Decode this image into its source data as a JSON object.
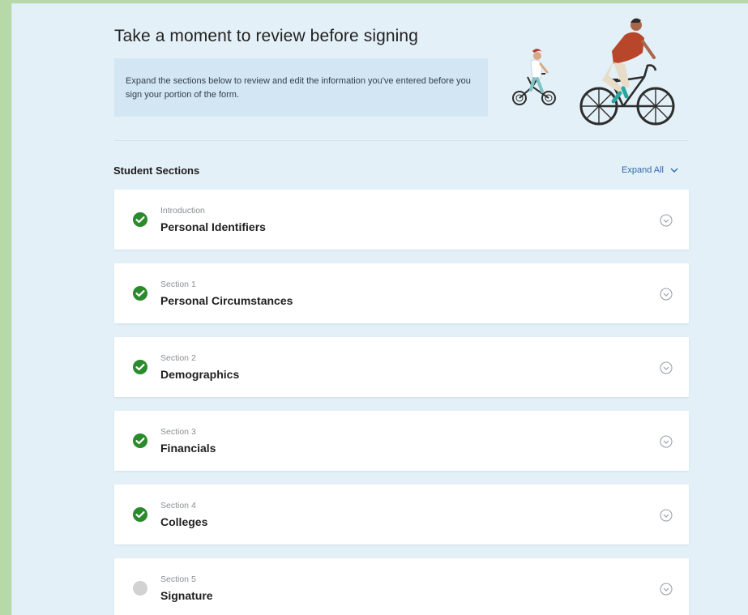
{
  "page": {
    "title": "Take a moment to review before signing",
    "intro": "Expand the sections below to review and edit the information you've entered before you sign your portion of the form."
  },
  "student_sections": {
    "heading": "Student Sections",
    "expand_all_label": "Expand All",
    "items": [
      {
        "kicker": "Introduction",
        "title": "Personal Identifiers",
        "status": "complete"
      },
      {
        "kicker": "Section 1",
        "title": "Personal Circumstances",
        "status": "complete"
      },
      {
        "kicker": "Section 2",
        "title": "Demographics",
        "status": "complete"
      },
      {
        "kicker": "Section 3",
        "title": "Financials",
        "status": "complete"
      },
      {
        "kicker": "Section 4",
        "title": "Colleges",
        "status": "complete"
      },
      {
        "kicker": "Section 5",
        "title": "Signature",
        "status": "incomplete"
      }
    ]
  },
  "icons": {
    "complete": "check-circle-icon",
    "incomplete": "empty-circle-icon",
    "expand": "chevron-down-circle-icon"
  },
  "colors": {
    "page_background": "#b7d9a8",
    "panel_background": "#e4f0f7",
    "intro_background": "#d2e6f3",
    "complete_green": "#2a8a2c",
    "incomplete_gray": "#d2d2d2",
    "link_blue": "#2f6aa6"
  }
}
